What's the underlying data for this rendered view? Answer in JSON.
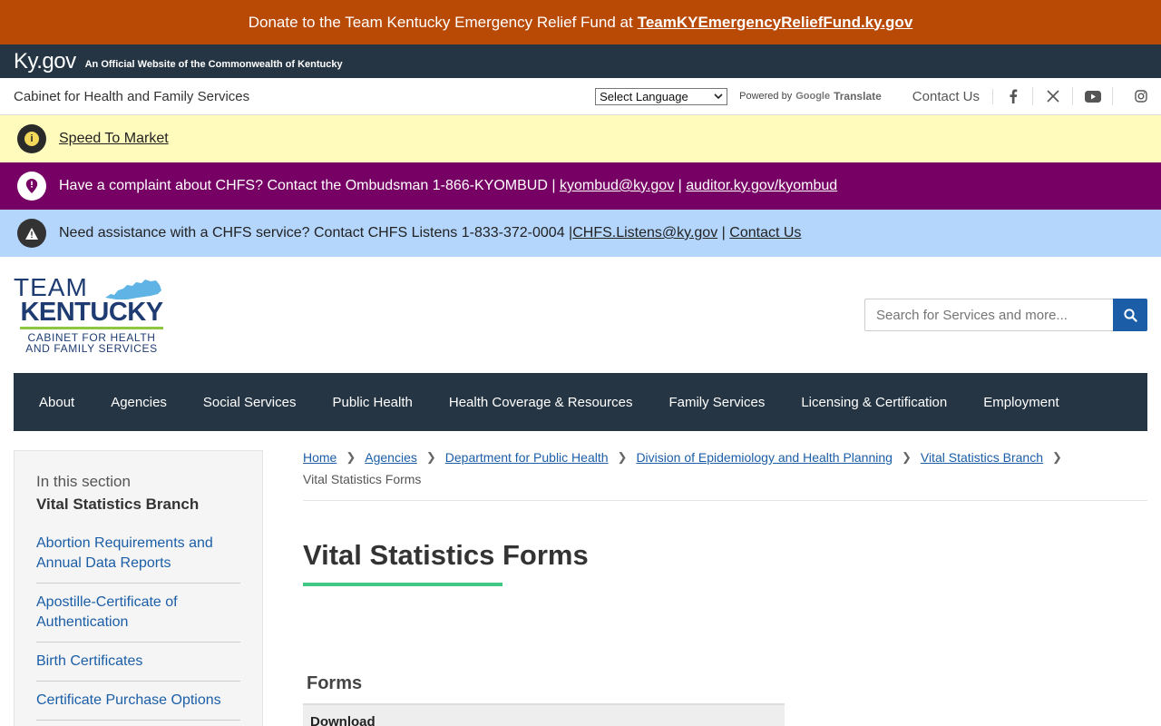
{
  "donate": {
    "text": "Donate to the Team Kentucky Emergency Relief Fund at",
    "link": "TeamKYEmergencyReliefFund.ky.gov"
  },
  "kygov": {
    "logo": "Ky.gov",
    "tagline": "An Official Website of the Commonwealth of Kentucky"
  },
  "utility": {
    "cabinet": "Cabinet for Health and Family Services",
    "language_select": "Select Language",
    "powered_by": "Powered by",
    "google": "Google",
    "translate": "Translate",
    "contact": "Contact Us"
  },
  "alerts": {
    "speed": {
      "link": "Speed To Market"
    },
    "complaint": {
      "text": "Have a complaint about CHFS? Contact the Ombudsman 1-866-KYOMBUD |",
      "email": "kyombud@ky.gov",
      "sep": "|",
      "link": "auditor.ky.gov/kyombud"
    },
    "assist": {
      "text": "Need assistance with a CHFS service? Contact CHFS Listens 1-833-372-0004 |",
      "email": "CHFS.Listens@ky.gov",
      "sep": "|",
      "link": "Contact Us"
    }
  },
  "logo": {
    "team": "TEAM",
    "kentucky": "KENTUCKY",
    "sub1": "CABINET FOR HEALTH",
    "sub2": "AND FAMILY SERVICES"
  },
  "search": {
    "placeholder": "Search for Services and more..."
  },
  "nav": [
    "About",
    "Agencies",
    "Social Services",
    "Public Health",
    "Health Coverage & Resources",
    "Family Services",
    "Licensing & Certification",
    "Employment"
  ],
  "sidebar": {
    "in_section": "In this section",
    "section_title": "Vital Statistics Branch",
    "items": [
      "Abortion Requirements and Annual Data Reports",
      "Apostille-Certificate of Authentication",
      "Birth Certificates",
      "Certificate Purchase Options"
    ]
  },
  "breadcrumb": {
    "items": [
      "Home",
      "Agencies",
      "Department for Public Health",
      "Division of Epidemiology and Health Planning",
      "Vital Statistics Branch"
    ],
    "current": "Vital Statistics Forms"
  },
  "page": {
    "title": "Vital Statistics Forms",
    "forms_heading": "Forms",
    "table_header": "Download"
  },
  "colors": {
    "donate_bg": "#b84a06",
    "header_dark": "#253544",
    "alert_yellow": "#fefbbd",
    "alert_purple": "#760064",
    "alert_blue": "#b4d5fc",
    "link_blue": "#1b5ea7",
    "title_rule": "#3fc985"
  }
}
